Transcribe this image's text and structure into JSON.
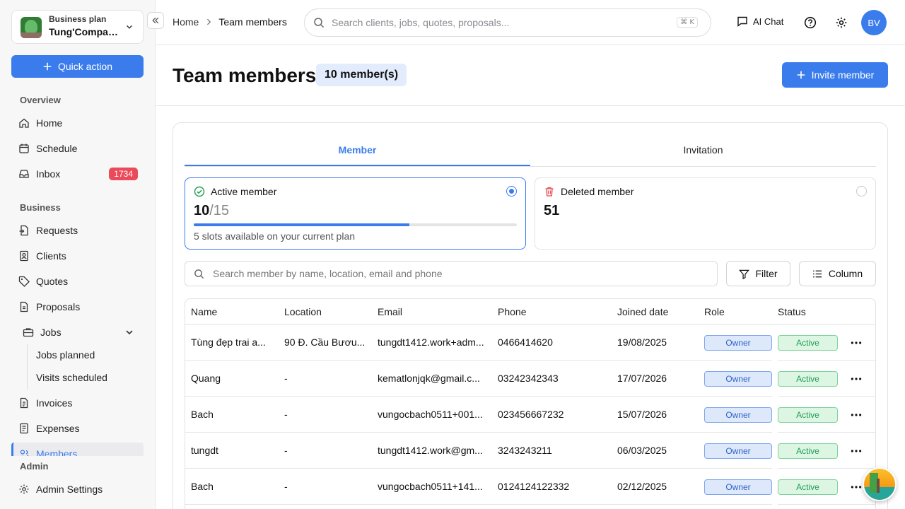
{
  "workspace": {
    "plan": "Business plan",
    "name": "Tung'Company"
  },
  "sidebar": {
    "quick_action": "Quick action",
    "overview_label": "Overview",
    "business_label": "Business",
    "admin_label": "Admin",
    "items": {
      "home": "Home",
      "schedule": "Schedule",
      "inbox": "Inbox",
      "inbox_count": "1734",
      "requests": "Requests",
      "clients": "Clients",
      "quotes": "Quotes",
      "proposals": "Proposals",
      "jobs": "Jobs",
      "jobs_planned": "Jobs planned",
      "visits_scheduled": "Visits scheduled",
      "invoices": "Invoices",
      "expenses": "Expenses",
      "members": "Members",
      "admin_settings": "Admin Settings"
    }
  },
  "topbar": {
    "breadcrumb_home": "Home",
    "breadcrumb_current": "Team members",
    "search_placeholder": "Search clients, jobs, quotes, proposals...",
    "shortcut": "⌘ K",
    "ai_chat": "AI Chat",
    "avatar_initials": "BV"
  },
  "header": {
    "title": "Team members",
    "count": "10 member(s)",
    "invite_label": "Invite member"
  },
  "tabs": {
    "member": "Member",
    "invitation": "Invitation"
  },
  "stats": {
    "active_label": "Active member",
    "active_count": "10",
    "active_total": "/15",
    "active_fraction": 0.667,
    "slots_note": "5 slots available on your current plan",
    "deleted_label": "Deleted member",
    "deleted_count": "51"
  },
  "member_search": {
    "placeholder": "Search member by name, location, email and phone"
  },
  "filter_label": "Filter",
  "column_label": "Column",
  "table": {
    "headers": {
      "name": "Name",
      "location": "Location",
      "email": "Email",
      "phone": "Phone",
      "joined": "Joined date",
      "role": "Role",
      "status": "Status"
    },
    "rows": [
      {
        "name": "Tùng đẹp trai a...",
        "location": "90 Đ. Cầu Bươu...",
        "email": "tungdt1412.work+adm...",
        "phone": "0466414620",
        "joined": "19/08/2025",
        "role": "Owner",
        "status": "Active"
      },
      {
        "name": "Quang",
        "location": "-",
        "email": "kematlonjqk@gmail.c...",
        "phone": "03242342343",
        "joined": "17/07/2026",
        "role": "Owner",
        "status": "Active"
      },
      {
        "name": "Bach",
        "location": "-",
        "email": "vungocbach0511+001...",
        "phone": "023456667232",
        "joined": "15/07/2026",
        "role": "Owner",
        "status": "Active"
      },
      {
        "name": "tungdt",
        "location": "-",
        "email": "tungdt1412.work@gm...",
        "phone": "3243243211",
        "joined": "06/03/2025",
        "role": "Owner",
        "status": "Active"
      },
      {
        "name": "Bach",
        "location": "-",
        "email": "vungocbach0511+141...",
        "phone": "0124124122332",
        "joined": "02/12/2025",
        "role": "Owner",
        "status": "Active"
      }
    ]
  },
  "colors": {
    "accent": "#3b7ced",
    "badge": "#ea4a5a",
    "role": "#2f63c9",
    "status": "#1f9d52"
  }
}
